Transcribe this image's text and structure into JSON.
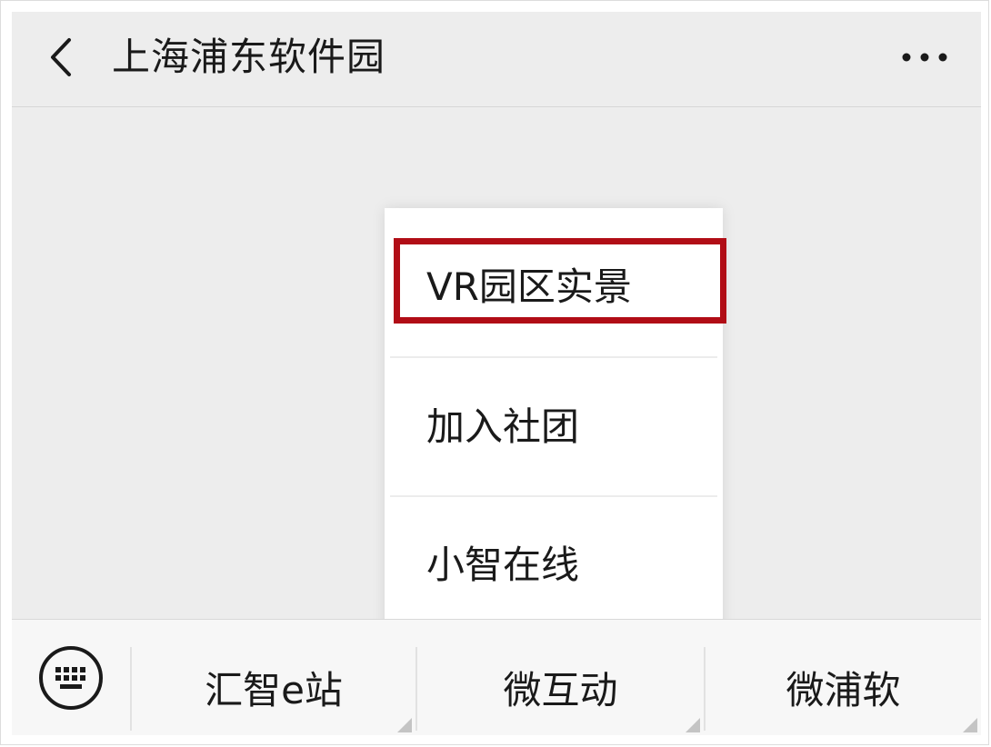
{
  "header": {
    "title": "上海浦东软件园",
    "back_icon": "chevron-left-icon",
    "more_icon": "more-horizontal-icon"
  },
  "popup_menu": {
    "items": [
      {
        "label": "VR园区实景",
        "highlighted": true
      },
      {
        "label": "加入社团",
        "highlighted": false
      },
      {
        "label": "小智在线",
        "highlighted": false
      }
    ],
    "highlight_color": "#b10d16"
  },
  "tabbar": {
    "keyboard_icon": "keyboard-icon",
    "tabs": [
      {
        "label": "汇智e站"
      },
      {
        "label": "微互动"
      },
      {
        "label": "微浦软"
      }
    ]
  },
  "colors": {
    "background": "#ededed",
    "tabbar_background": "#f7f7f7",
    "text": "#1a1a1a"
  }
}
